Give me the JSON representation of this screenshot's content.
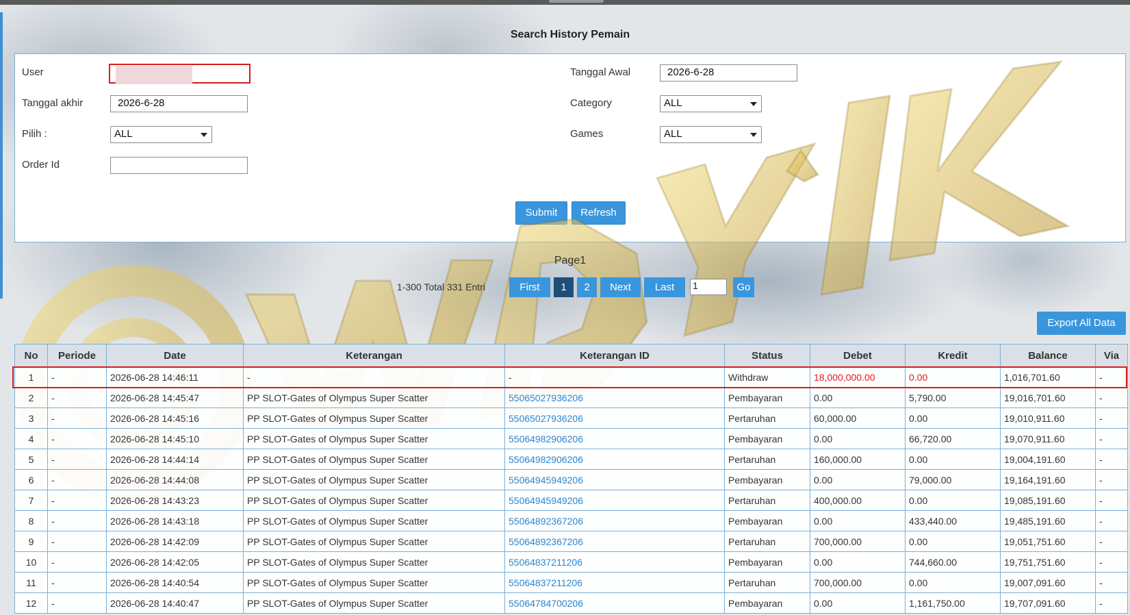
{
  "page": {
    "title": "Search History Pemain"
  },
  "form": {
    "user_label": "User",
    "user_value": "",
    "tanggal_awal_label": "Tanggal Awal",
    "tanggal_awal_value": "2026-6-28",
    "tanggal_akhir_label": "Tanggal akhir",
    "tanggal_akhir_value": "2026-6-28",
    "category_label": "Category",
    "category_value": "ALL",
    "pilih_label": "Pilih  :",
    "pilih_value": "ALL",
    "games_label": "Games",
    "games_value": "ALL",
    "order_id_label": "Order Id",
    "order_id_value": "",
    "submit_label": "Submit",
    "refresh_label": "Refresh"
  },
  "pagination": {
    "page_label": "Page1",
    "info": "1-300 Total 331 Entri",
    "first": "First",
    "pages": [
      "1",
      "2"
    ],
    "active_page": "1",
    "next": "Next",
    "last": "Last",
    "page_input_value": "1",
    "go": "Go"
  },
  "export_label": "Export All Data",
  "watermark_text": "WDYL IK",
  "table": {
    "headers": [
      "No",
      "Periode",
      "Date",
      "Keterangan",
      "Keterangan ID",
      "Status",
      "Debet",
      "Kredit",
      "Balance",
      "Via"
    ],
    "rows": [
      [
        "1",
        "-",
        "2026-06-28 14:46:11",
        "-",
        "-",
        "Withdraw",
        "18,000,000.00",
        "0.00",
        "1,016,701.60",
        "-"
      ],
      [
        "2",
        "-",
        "2026-06-28 14:45:47",
        "PP SLOT-Gates of Olympus Super Scatter",
        "55065027936206",
        "Pembayaran",
        "0.00",
        "5,790.00",
        "19,016,701.60",
        "-"
      ],
      [
        "3",
        "-",
        "2026-06-28 14:45:16",
        "PP SLOT-Gates of Olympus Super Scatter",
        "55065027936206",
        "Pertaruhan",
        "60,000.00",
        "0.00",
        "19,010,911.60",
        "-"
      ],
      [
        "4",
        "-",
        "2026-06-28 14:45:10",
        "PP SLOT-Gates of Olympus Super Scatter",
        "55064982906206",
        "Pembayaran",
        "0.00",
        "66,720.00",
        "19,070,911.60",
        "-"
      ],
      [
        "5",
        "-",
        "2026-06-28 14:44:14",
        "PP SLOT-Gates of Olympus Super Scatter",
        "55064982906206",
        "Pertaruhan",
        "160,000.00",
        "0.00",
        "19,004,191.60",
        "-"
      ],
      [
        "6",
        "-",
        "2026-06-28 14:44:08",
        "PP SLOT-Gates of Olympus Super Scatter",
        "55064945949206",
        "Pembayaran",
        "0.00",
        "79,000.00",
        "19,164,191.60",
        "-"
      ],
      [
        "7",
        "-",
        "2026-06-28 14:43:23",
        "PP SLOT-Gates of Olympus Super Scatter",
        "55064945949206",
        "Pertaruhan",
        "400,000.00",
        "0.00",
        "19,085,191.60",
        "-"
      ],
      [
        "8",
        "-",
        "2026-06-28 14:43:18",
        "PP SLOT-Gates of Olympus Super Scatter",
        "55064892367206",
        "Pembayaran",
        "0.00",
        "433,440.00",
        "19,485,191.60",
        "-"
      ],
      [
        "9",
        "-",
        "2026-06-28 14:42:09",
        "PP SLOT-Gates of Olympus Super Scatter",
        "55064892367206",
        "Pertaruhan",
        "700,000.00",
        "0.00",
        "19,051,751.60",
        "-"
      ],
      [
        "10",
        "-",
        "2026-06-28 14:42:05",
        "PP SLOT-Gates of Olympus Super Scatter",
        "55064837211206",
        "Pembayaran",
        "0.00",
        "744,660.00",
        "19,751,751.60",
        "-"
      ],
      [
        "11",
        "-",
        "2026-06-28 14:40:54",
        "PP SLOT-Gates of Olympus Super Scatter",
        "55064837211206",
        "Pertaruhan",
        "700,000.00",
        "0.00",
        "19,007,091.60",
        "-"
      ],
      [
        "12",
        "-",
        "2026-06-28 14:40:47",
        "PP SLOT-Gates of Olympus Super Scatter",
        "55064784700206",
        "Pembayaran",
        "0.00",
        "1,161,750.00",
        "19,707,091.60",
        "-"
      ]
    ]
  },
  "colors": {
    "accent": "#3a96dc",
    "active_page": "#1d4f7a",
    "link": "#2b86d1",
    "negative": "#e01b1b",
    "highlight_border": "#d61d1d",
    "watermark_gold": "#d6b84a"
  }
}
